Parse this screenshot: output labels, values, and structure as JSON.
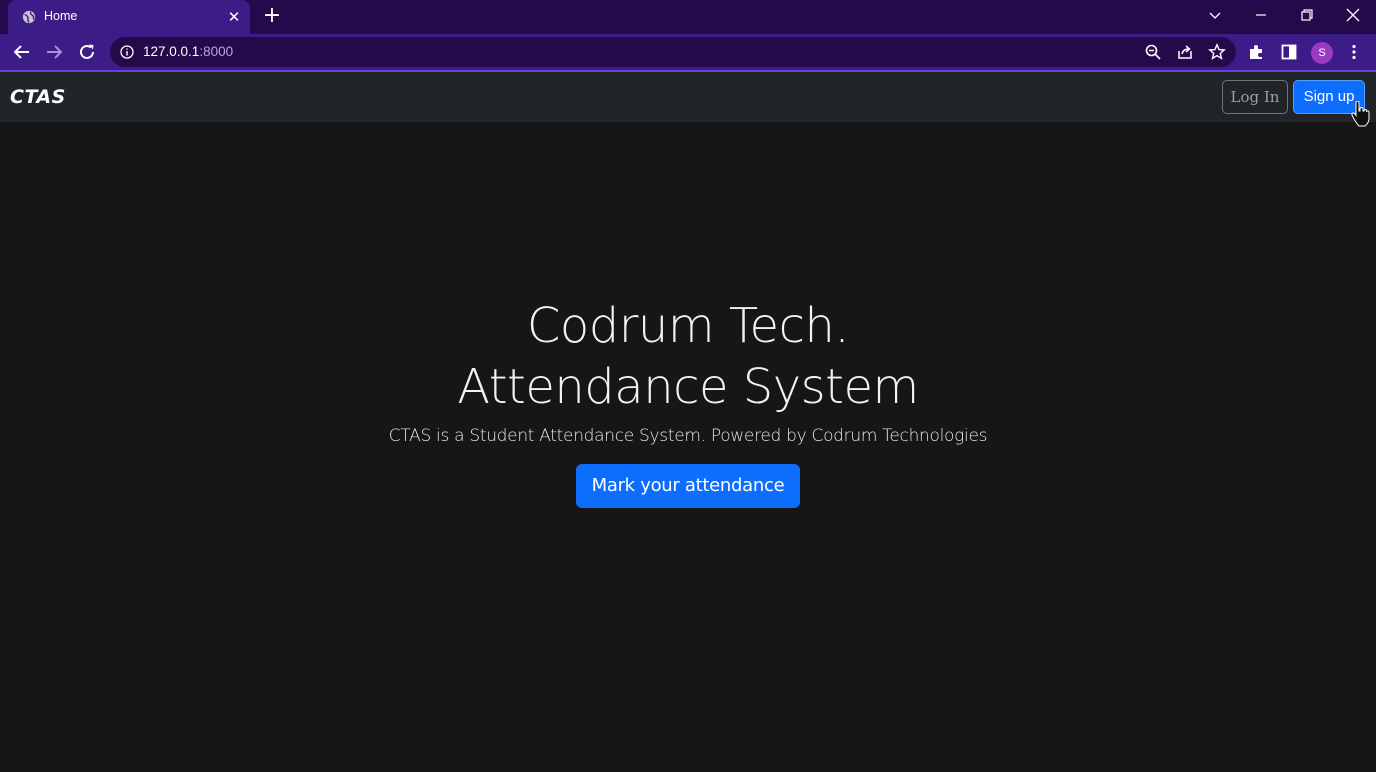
{
  "browser": {
    "tab_title": "Home",
    "url_host": "127.0.0.1",
    "url_port": ":8000",
    "profile_initial": "S",
    "icons": [
      "globe-icon",
      "close-icon",
      "plus-icon",
      "back-icon",
      "forward-icon",
      "reload-icon",
      "info-icon",
      "zoom-icon",
      "share-icon",
      "star-icon",
      "extensions-icon",
      "side-panel-icon",
      "menu-icon",
      "minimize-icon",
      "restore-icon",
      "window-close-icon",
      "chevron-down-icon"
    ]
  },
  "navbar": {
    "brand": "CTAS",
    "login_label": "Log In",
    "signup_label": "Sign up"
  },
  "hero": {
    "title": "Codrum Tech. Attendance System",
    "lead": "CTAS is a Student Attendance System. Powered by Codrum Technologies",
    "cta_label": "Mark your attendance"
  },
  "colors": {
    "page_bg": "#161616",
    "navbar_bg": "#212529",
    "primary": "#0d6efd",
    "chrome_frame": "#240a4a",
    "chrome_toolbar": "#3c1c86"
  }
}
